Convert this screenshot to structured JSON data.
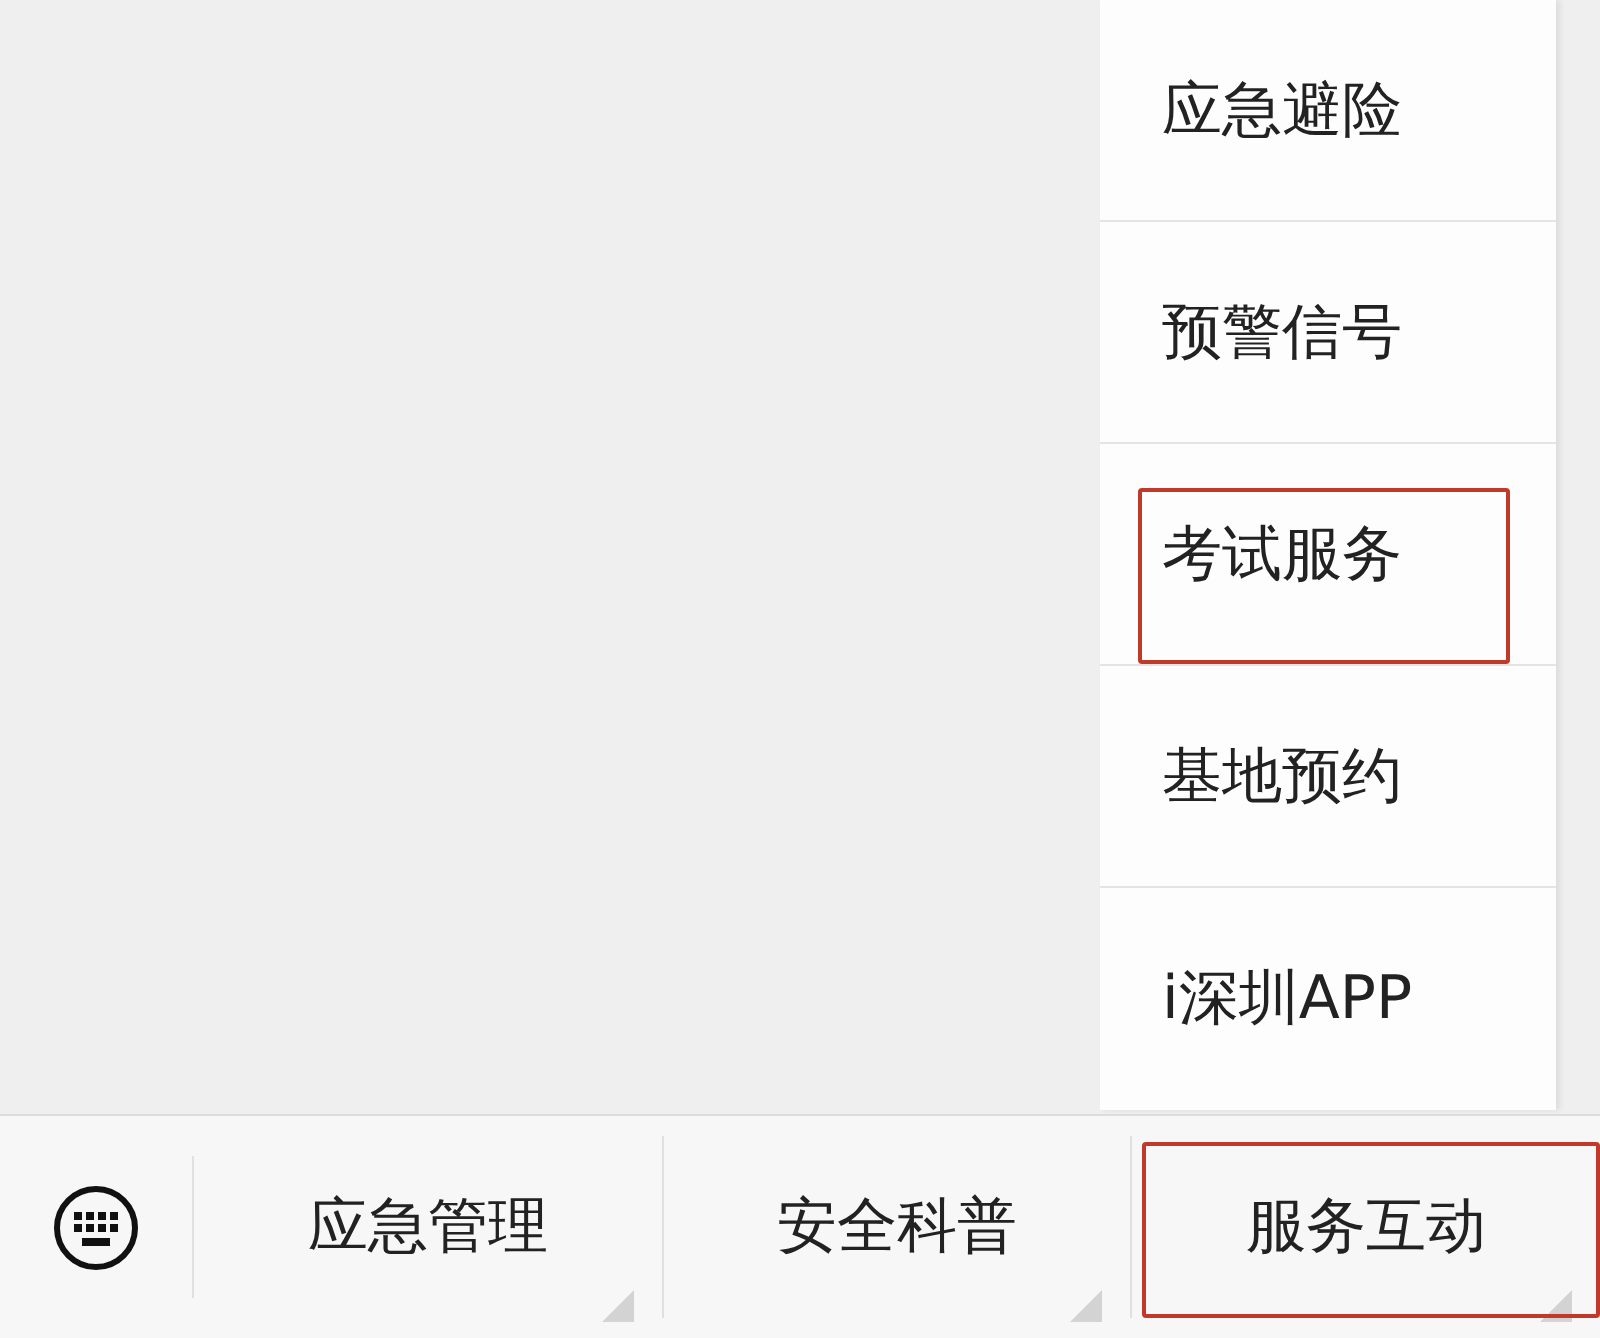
{
  "submenu": {
    "items": [
      {
        "label": "应急避险",
        "highlighted": false
      },
      {
        "label": "预警信号",
        "highlighted": false
      },
      {
        "label": "考试服务",
        "highlighted": true
      },
      {
        "label": "基地预约",
        "highlighted": false
      },
      {
        "label": "i深圳APP",
        "highlighted": false
      }
    ]
  },
  "menu_bar": {
    "items": [
      {
        "label": "应急管理",
        "highlighted": false
      },
      {
        "label": "安全科普",
        "highlighted": false
      },
      {
        "label": "服务互动",
        "highlighted": true
      }
    ]
  }
}
